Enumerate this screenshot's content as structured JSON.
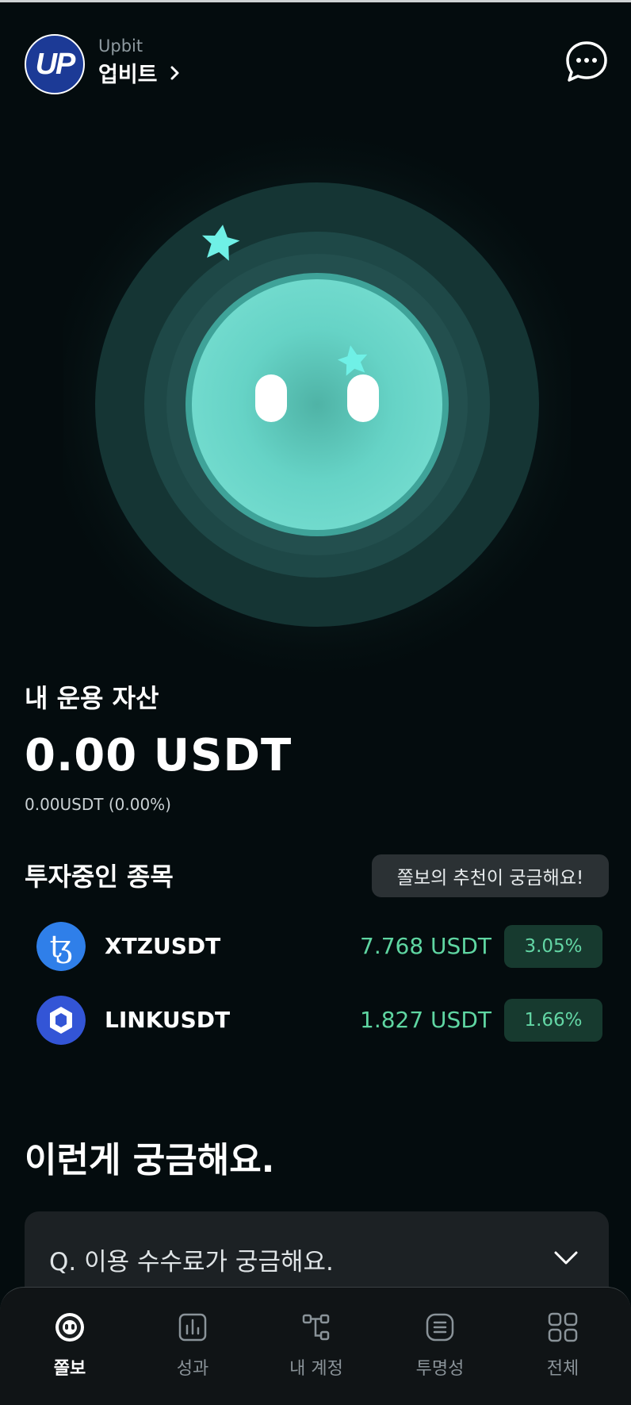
{
  "header": {
    "brand_logo_text": "UP",
    "brand_sub": "Upbit",
    "brand_name": "업비트",
    "icons": [
      "upbit-logo",
      "chevron-right-icon",
      "chat-bubble-icon"
    ]
  },
  "assets": {
    "title": "내 운용 자산",
    "value": "0.00 USDT",
    "change": "0.00USDT (0.00%)"
  },
  "holdings": {
    "title": "투자중인 종목",
    "recommend_label": "쫄보의 추천이 궁금해요!",
    "items": [
      {
        "name": "XTZUSDT",
        "price": "7.768 USDT",
        "rate": "3.05%",
        "icon": "tezos-icon",
        "color": "#2f7fe9"
      },
      {
        "name": "LINKUSDT",
        "price": "1.827 USDT",
        "rate": "1.66%",
        "icon": "chainlink-icon",
        "color": "#3355d6"
      }
    ]
  },
  "faq": {
    "title": "이런게 궁금해요.",
    "question": "Q. 이용 수수료가 궁금해요."
  },
  "nav": {
    "items": [
      {
        "label": "쫄보",
        "icon": "mascot-icon",
        "active": true
      },
      {
        "label": "성과",
        "icon": "bar-chart-icon",
        "active": false
      },
      {
        "label": "내 계정",
        "icon": "account-tree-icon",
        "active": false
      },
      {
        "label": "투명성",
        "icon": "document-icon",
        "active": false
      },
      {
        "label": "전체",
        "icon": "grid-icon",
        "active": false
      }
    ]
  },
  "colors": {
    "background": "#040c0e",
    "accent_mint": "#6fd8cc",
    "positive": "#5fd6a2",
    "brand_blue": "#1c3a96"
  }
}
